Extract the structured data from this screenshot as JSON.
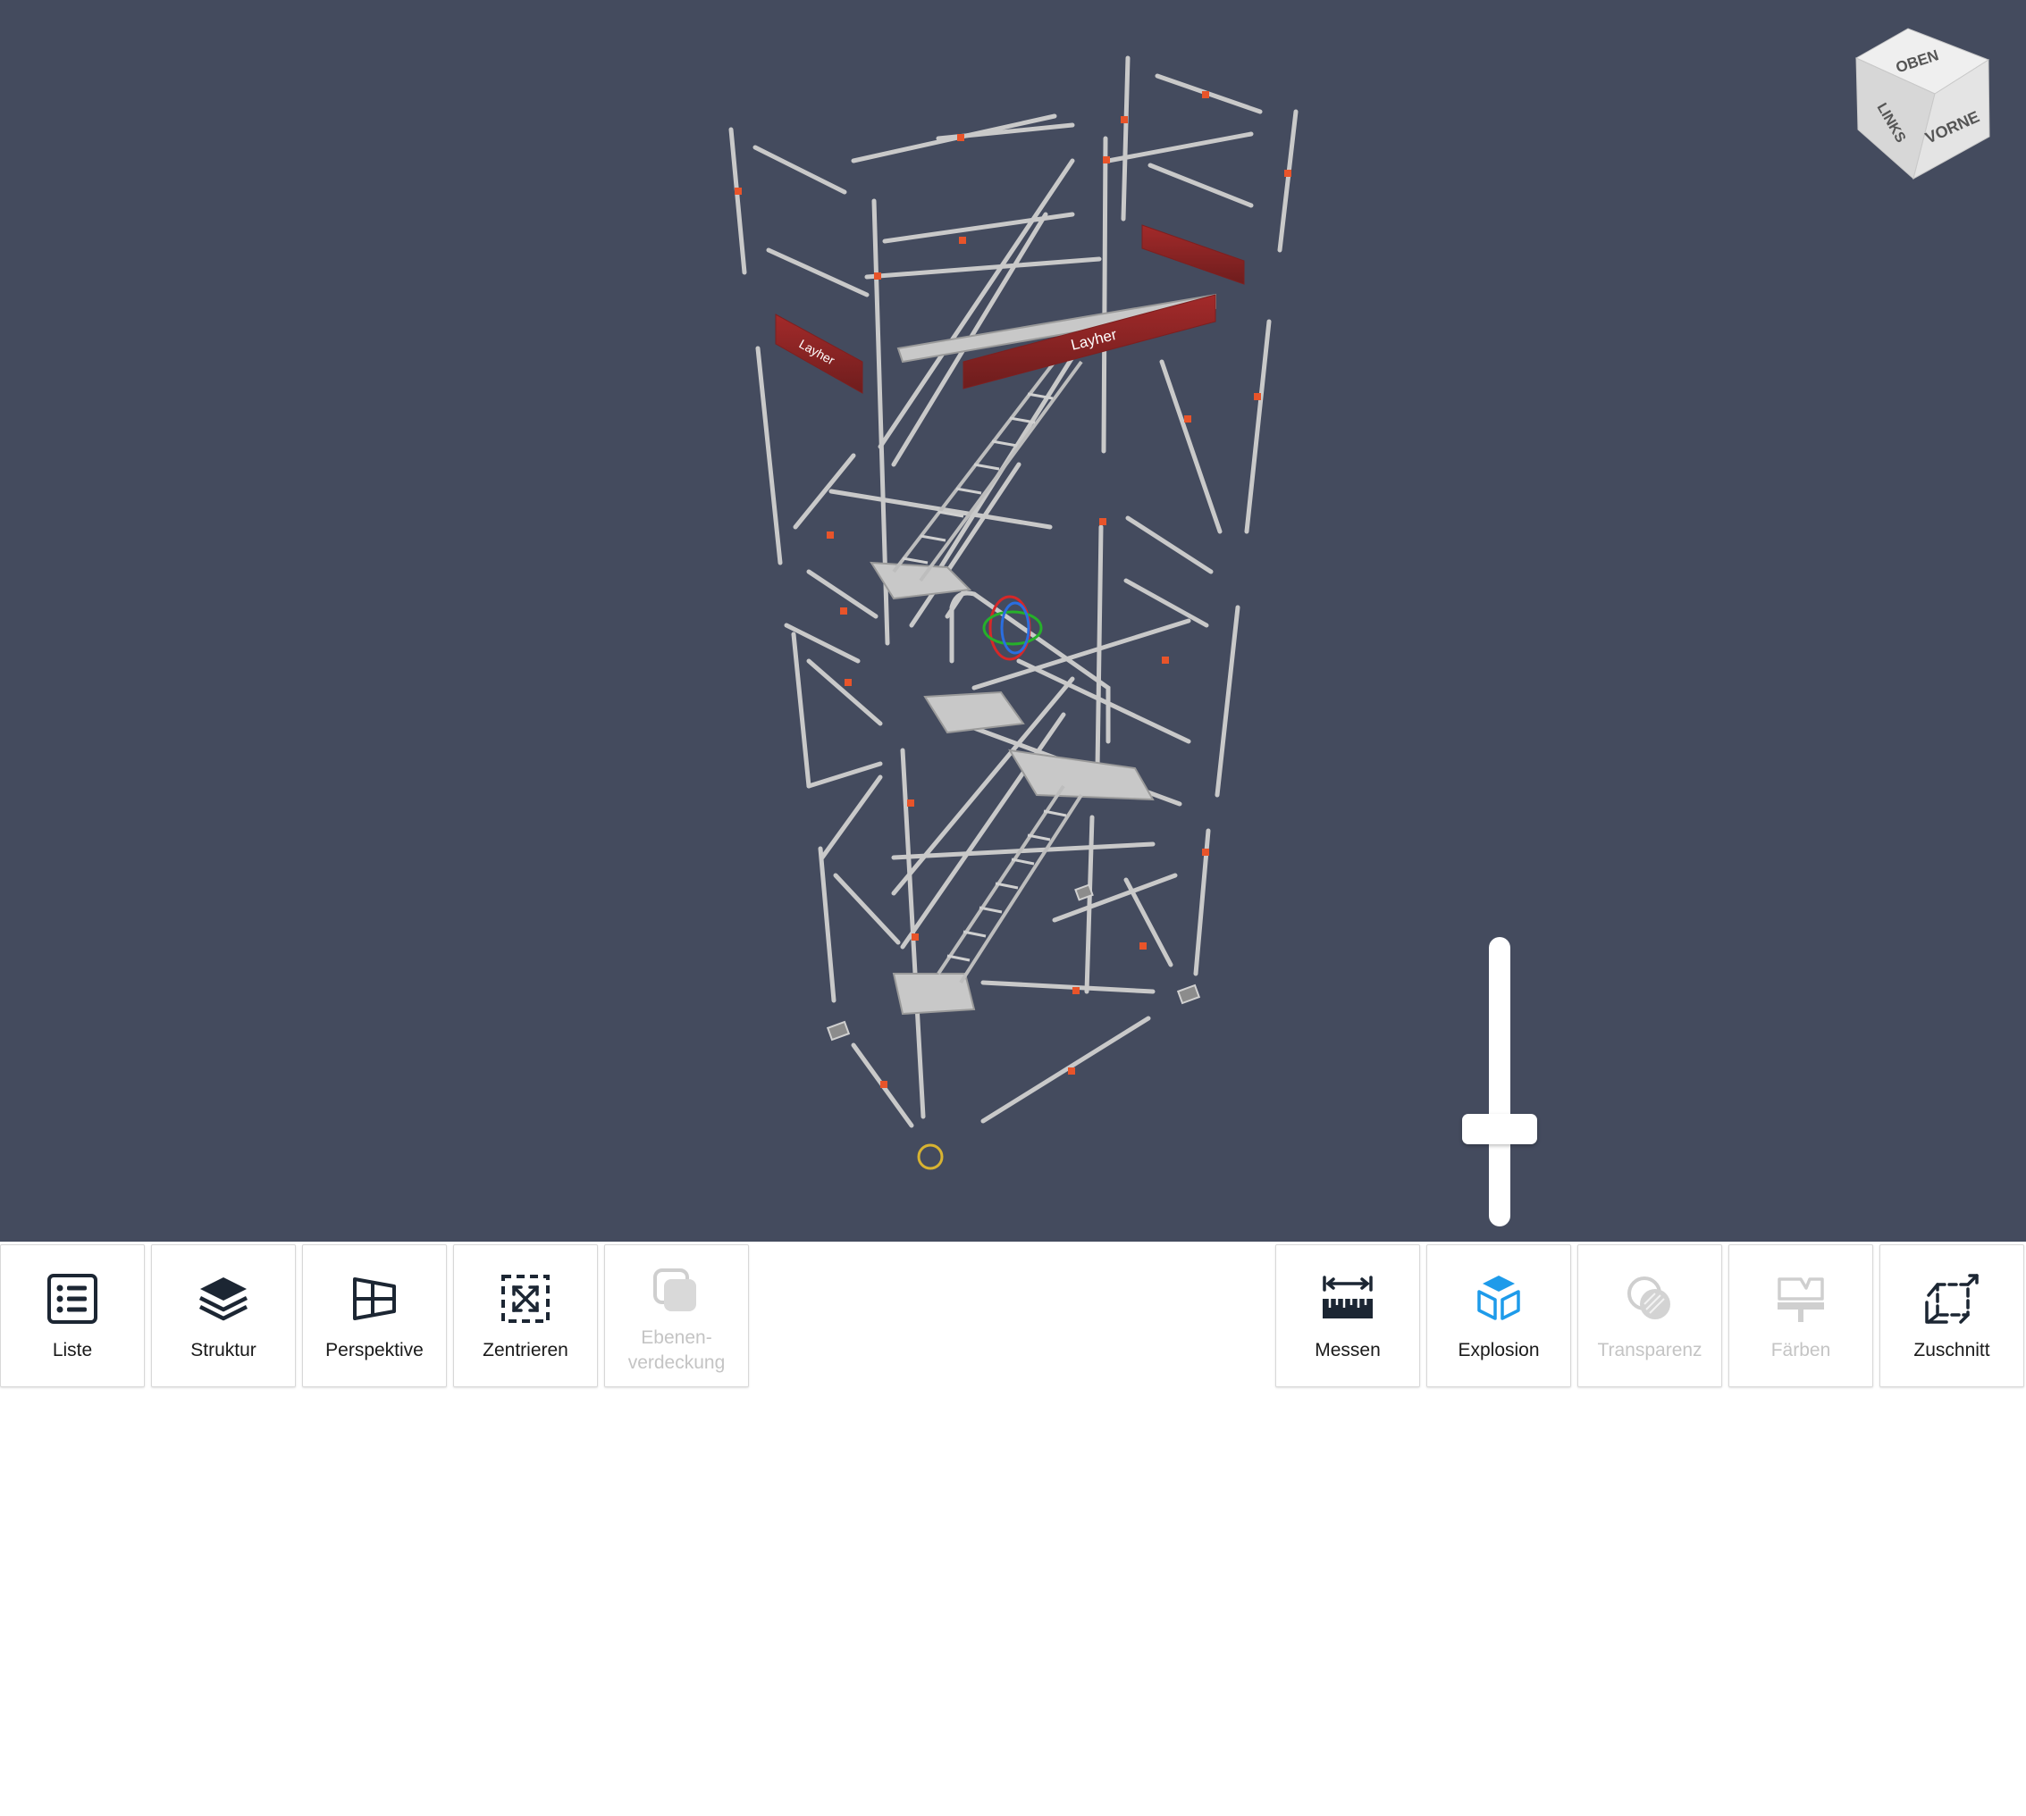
{
  "viewport": {
    "background": "#444b5e",
    "model_brand_label": "Layher",
    "nav_cube": {
      "top_face": "OBEN",
      "left_face": "LINKS",
      "front_face": "VORNE"
    },
    "explosion_slider": {
      "value": 0.25
    }
  },
  "toolbar": {
    "left": [
      {
        "id": "liste",
        "label": "Liste",
        "icon": "list-icon",
        "enabled": true
      },
      {
        "id": "struktur",
        "label": "Struktur",
        "icon": "layers-icon",
        "enabled": true
      },
      {
        "id": "perspektive",
        "label": "Perspektive",
        "icon": "perspective-icon",
        "enabled": true
      },
      {
        "id": "zentrieren",
        "label": "Zentrieren",
        "icon": "center-icon",
        "enabled": true
      },
      {
        "id": "ebenenverdeckung",
        "label_line1": "Ebenen-",
        "label_line2": "verdeckung",
        "icon": "layer-hide-icon",
        "enabled": false
      }
    ],
    "right": [
      {
        "id": "messen",
        "label": "Messen",
        "icon": "ruler-icon",
        "enabled": true
      },
      {
        "id": "explosion",
        "label": "Explosion",
        "icon": "explode-cube-icon",
        "enabled": true,
        "active": true
      },
      {
        "id": "transparenz",
        "label": "Transparenz",
        "icon": "transparency-icon",
        "enabled": false
      },
      {
        "id": "faerben",
        "label": "Färben",
        "icon": "paint-icon",
        "enabled": false
      },
      {
        "id": "zuschnitt",
        "label": "Zuschnitt",
        "icon": "crop-icon",
        "enabled": true
      }
    ],
    "accent_color": "#1e9bea",
    "disabled_color": "#c4c4c4"
  }
}
